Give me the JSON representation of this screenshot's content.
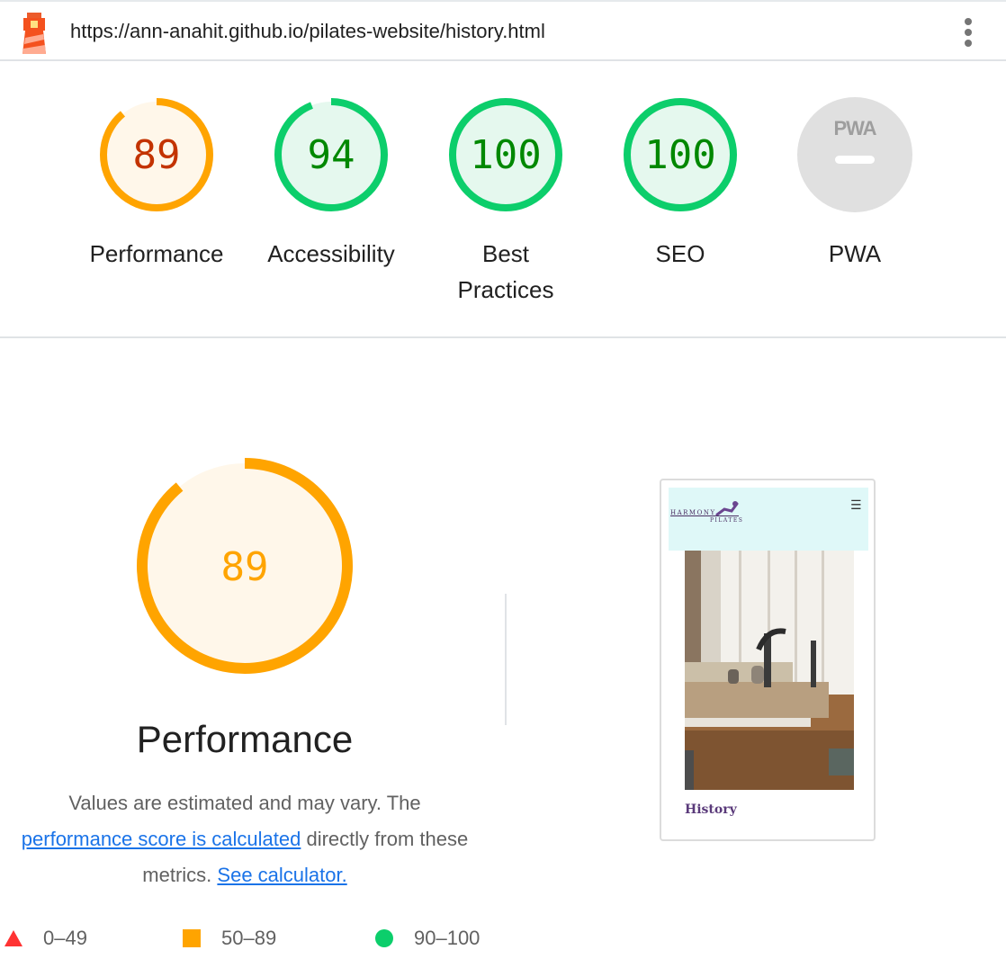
{
  "header": {
    "url": "https://ann-anahit.github.io/pilates-website/history.html",
    "logo_icon": "lighthouse-icon",
    "menu_icon": "kebab-menu-icon"
  },
  "gauges": [
    {
      "id": "performance",
      "score": "89",
      "label": "Performance",
      "status": "average",
      "progress": 0.89
    },
    {
      "id": "accessibility",
      "score": "94",
      "label": "Accessibility",
      "status": "pass",
      "progress": 0.94
    },
    {
      "id": "best-practices",
      "score": "100",
      "label": "Best Practices",
      "status": "pass",
      "progress": 1.0
    },
    {
      "id": "seo",
      "score": "100",
      "label": "SEO",
      "status": "pass",
      "progress": 1.0
    },
    {
      "id": "pwa",
      "badge": "PWA",
      "label": "PWA",
      "status": "not-applicable"
    }
  ],
  "main": {
    "score": "89",
    "progress": 0.89,
    "title": "Performance",
    "desc_prefix": "Values are estimated and may vary. The ",
    "desc_link": "performance score is calculated",
    "desc_middle": " directly from these metrics. ",
    "desc_calc_link": "See calculator."
  },
  "legend": [
    {
      "range": "0–49",
      "shape": "triangle",
      "color": "#ff3333"
    },
    {
      "range": "50–89",
      "shape": "square",
      "color": "#ffa400"
    },
    {
      "range": "90–100",
      "shape": "circle",
      "color": "#0cce6b"
    }
  ],
  "thumbnail": {
    "brand_top": "HARMONY",
    "brand_bottom": "PILATES",
    "menu_icon": "hamburger-icon",
    "heading": "History"
  },
  "colors": {
    "pass": "#0cce6b",
    "pass_text": "#008800",
    "pass_bg": "#e5f8ee",
    "average": "#ffa400",
    "average_text": "#c33300",
    "average_bg": "#fff7ea",
    "neutral_bg": "#e0e0e0",
    "neutral_fg": "#9e9e9e"
  }
}
